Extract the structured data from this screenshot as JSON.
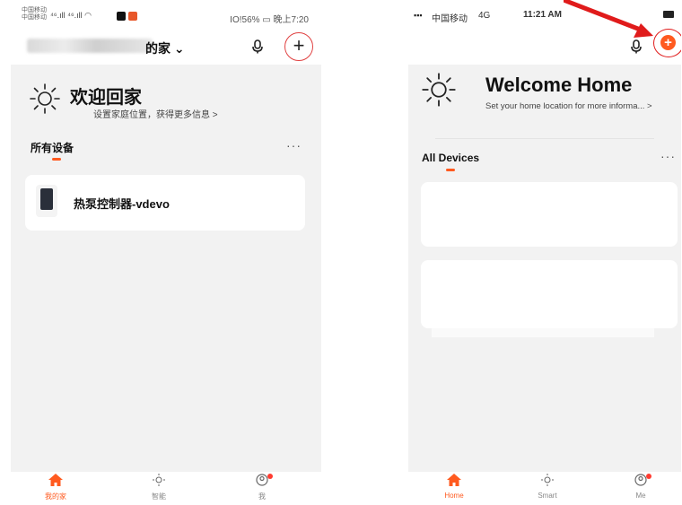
{
  "left": {
    "status": {
      "carrier1": "中国移动",
      "carrier2": "中国移动",
      "signal": "⁴⁶.ıll ⁴⁶.ıll ◠",
      "right": "IO!56% ▭ 晚上7:20"
    },
    "header": {
      "home_name": "的家 ⌄",
      "add_symbol": "+"
    },
    "welcome": {
      "title": "欢迎回家",
      "subtitle": "设置家庭位置，获得更多信息 >"
    },
    "section": {
      "title": "所有设备",
      "more": "···"
    },
    "devices": [
      {
        "name": "热泵控制器-vdevo"
      }
    ],
    "tabs": [
      {
        "label": "我的家",
        "icon": "home-icon",
        "active": true
      },
      {
        "label": "智能",
        "icon": "sun-icon",
        "active": false
      },
      {
        "label": "我",
        "icon": "profile-icon",
        "active": false
      }
    ]
  },
  "right": {
    "status": {
      "carrier": "中国移动",
      "network": "4G",
      "time": "11:21 AM"
    },
    "welcome": {
      "title": "Welcome Home",
      "subtitle": "Set your home location for more informa... >"
    },
    "section": {
      "title": "All Devices",
      "more": "···"
    },
    "tabs": [
      {
        "label": "Home",
        "icon": "home-icon",
        "active": true
      },
      {
        "label": "Smart",
        "icon": "sun-icon",
        "active": false
      },
      {
        "label": "Me",
        "icon": "profile-icon",
        "active": false
      }
    ]
  },
  "colors": {
    "accent": "#ff5a1f",
    "highlight_red": "#e01b1b",
    "background": "#f2f2f2"
  }
}
